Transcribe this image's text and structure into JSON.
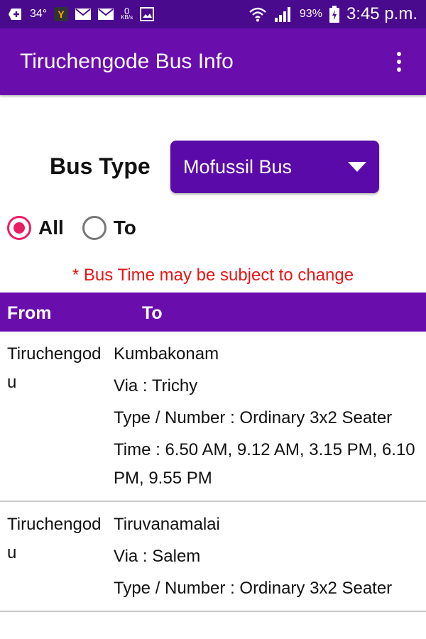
{
  "status_bar": {
    "temperature": "34°",
    "network_speed": "0",
    "network_unit": "KB/s",
    "battery": "93%",
    "time": "3:45 p.m."
  },
  "app_bar": {
    "title": "Tiruchengode Bus Info",
    "menu_icon": "more-vert-icon"
  },
  "filters": {
    "bus_type_label": "Bus Type",
    "bus_type_value": "Mofussil Bus",
    "radio_all": "All",
    "radio_to": "To",
    "selected": "All"
  },
  "notice": "* Bus Time may be subject to change",
  "table": {
    "headers": {
      "from": "From",
      "to": "To"
    },
    "rows": [
      {
        "from": "Tiruchengodu",
        "to": "Kumbakonam",
        "via": "Via : Trichy",
        "type": "Type / Number :  Ordinary 3x2 Seater",
        "time": "Time : 6.50 AM,  9.12 AM,  3.15 PM,  6.10 PM,  9.55 PM"
      },
      {
        "from": "Tiruchengodu",
        "to": "Tiruvanamalai",
        "via": "Via : Salem",
        "type": "Type / Number :  Ordinary 3x2 Seater"
      }
    ]
  },
  "colors": {
    "status_bar": "#4a0a8e",
    "primary": "#6a0dad",
    "accent": "#e91e63",
    "notice": "#e81515"
  }
}
